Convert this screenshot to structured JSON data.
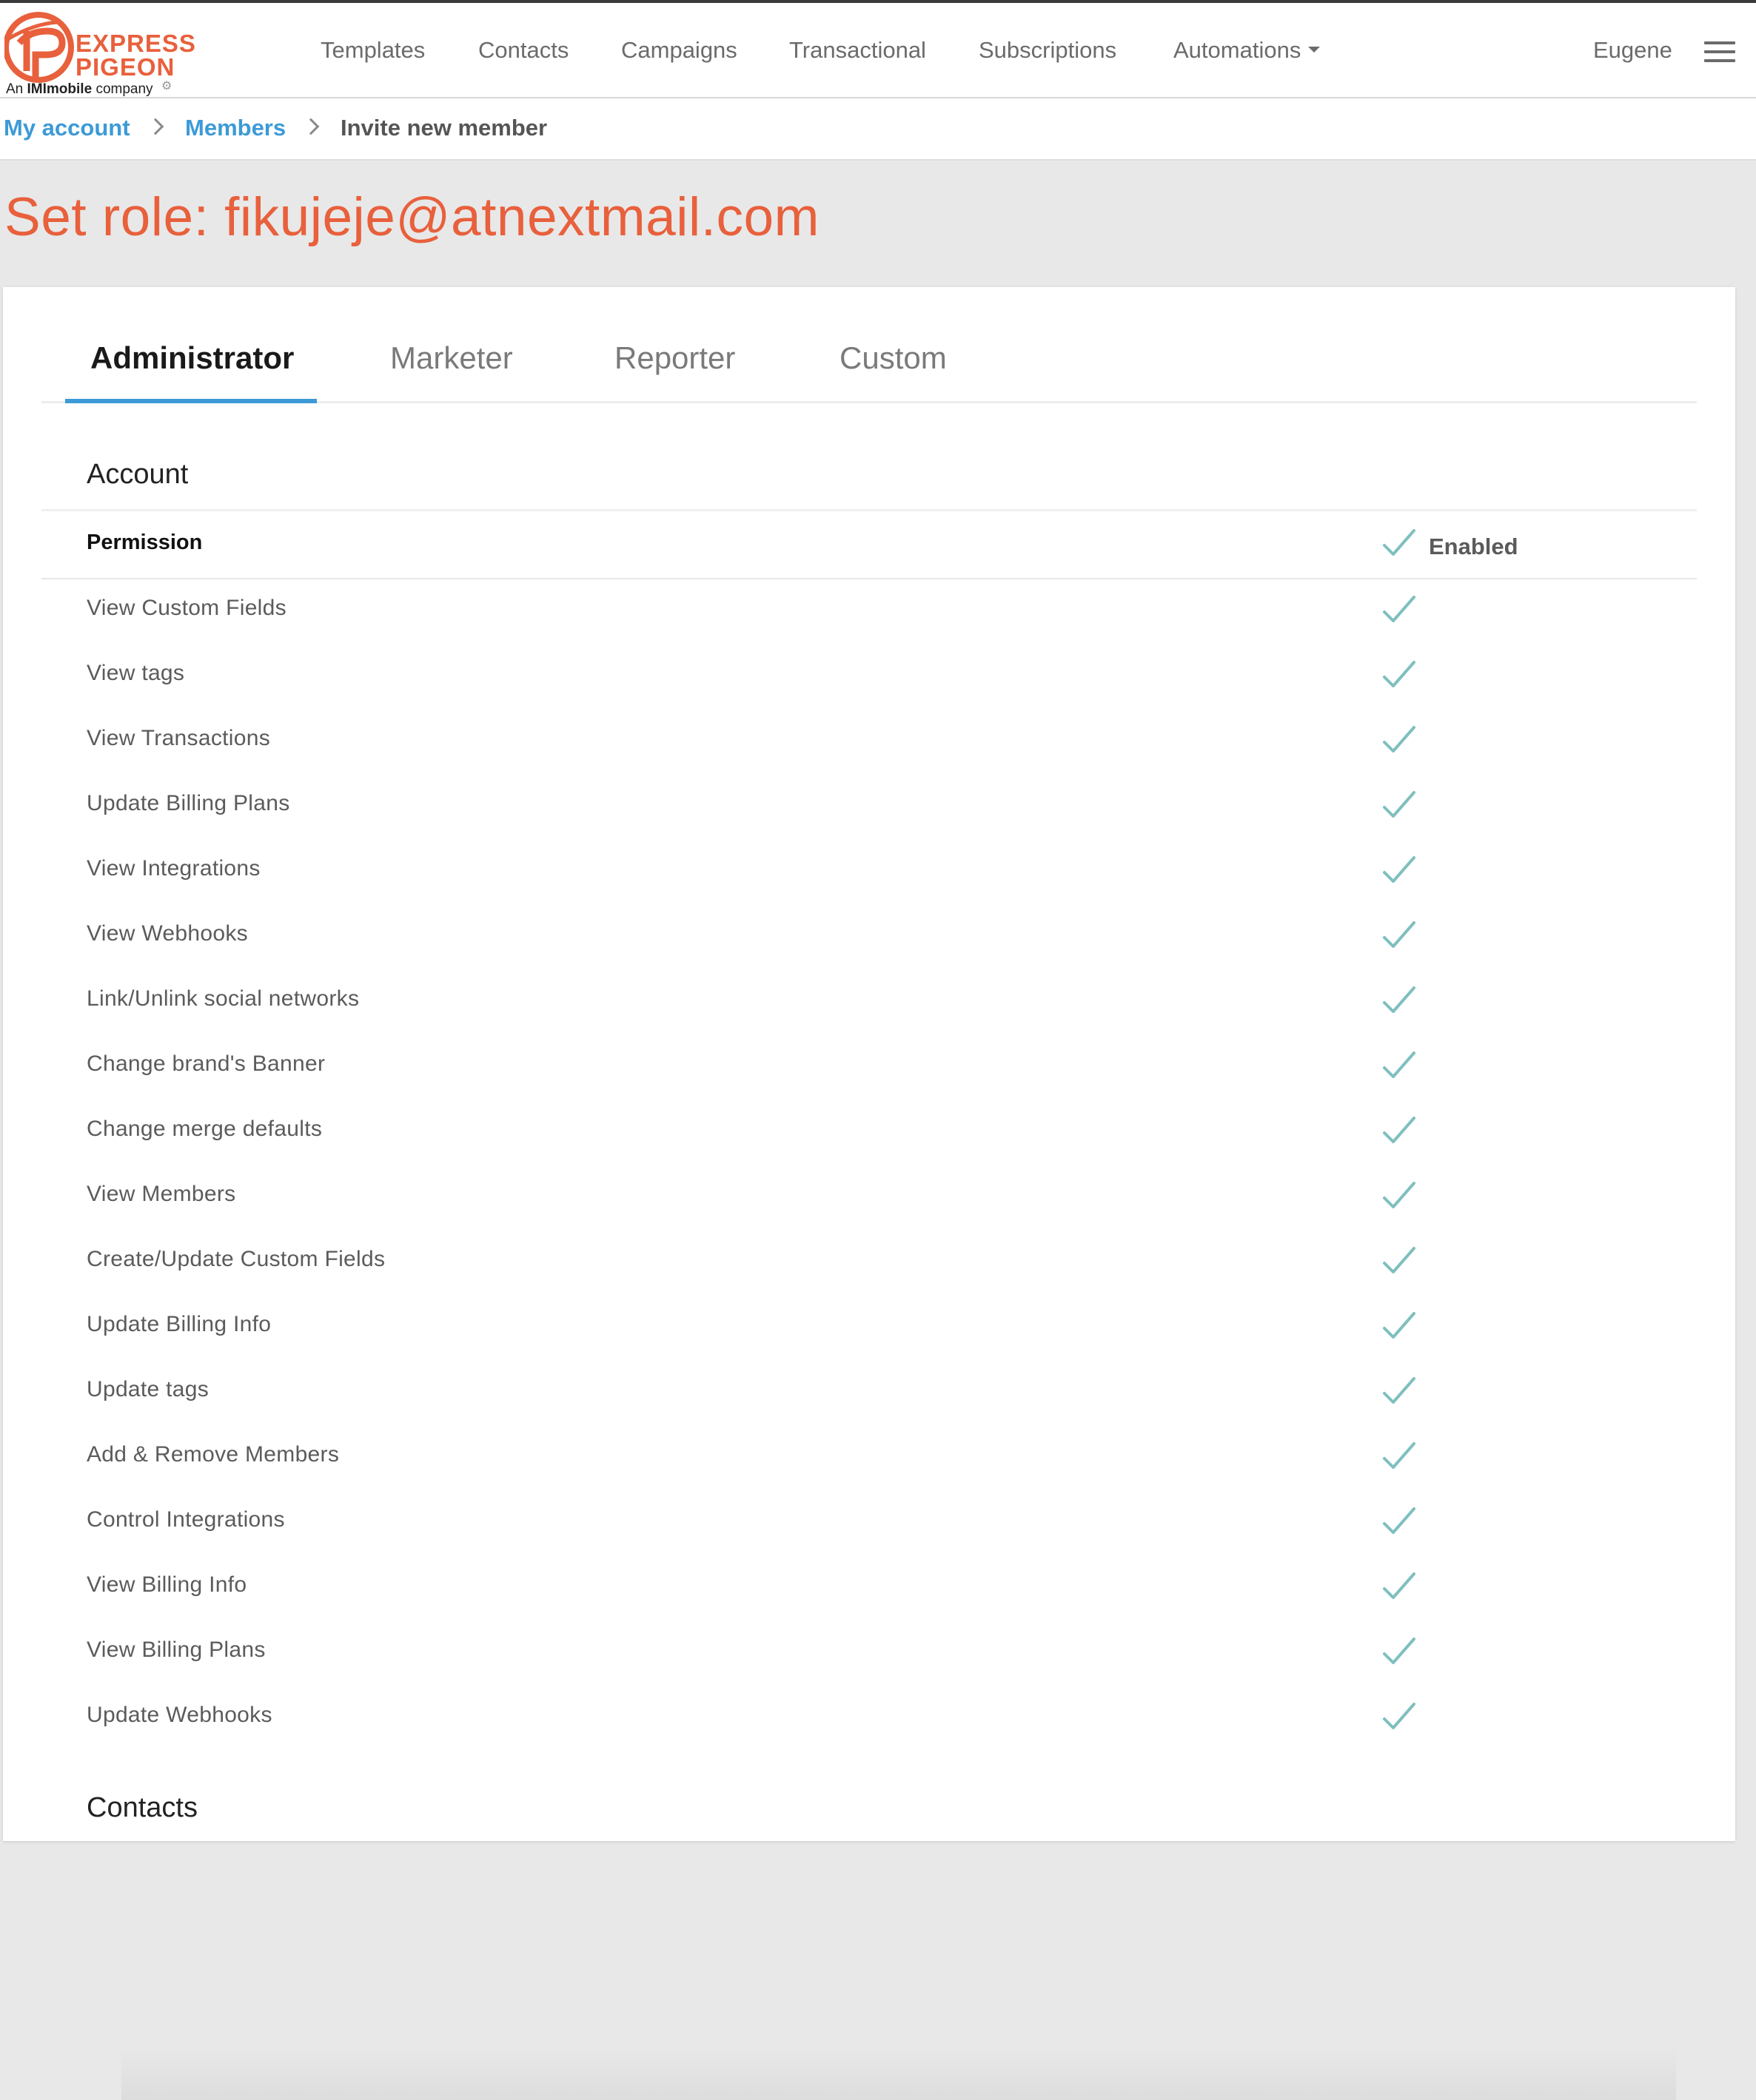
{
  "brand": {
    "line1": "EXPRESS",
    "line2": "PIGEON",
    "sub_prefix": "An",
    "sub_bold": "IMImobile",
    "sub_suffix": "company",
    "accent": "#e8603c",
    "link_color": "#3d9ad6",
    "check_color": "#7fbfbf"
  },
  "nav": {
    "items": [
      {
        "label": "Templates"
      },
      {
        "label": "Contacts"
      },
      {
        "label": "Campaigns"
      },
      {
        "label": "Transactional"
      },
      {
        "label": "Subscriptions"
      },
      {
        "label": "Automations"
      }
    ],
    "user": "Eugene"
  },
  "breadcrumb": {
    "items": [
      {
        "label": "My account"
      },
      {
        "label": "Members"
      },
      {
        "label": "Invite new member"
      }
    ]
  },
  "page": {
    "title": "Set role: fikujeje@atnextmail.com"
  },
  "tabs": [
    {
      "label": "Administrator",
      "active": true
    },
    {
      "label": "Marketer",
      "active": false
    },
    {
      "label": "Reporter",
      "active": false
    },
    {
      "label": "Custom",
      "active": false
    }
  ],
  "account_section": {
    "title": "Account",
    "header_permission": "Permission",
    "header_enabled": "Enabled",
    "permissions": [
      {
        "label": "View Custom Fields",
        "enabled": true
      },
      {
        "label": "View tags",
        "enabled": true
      },
      {
        "label": "View Transactions",
        "enabled": true
      },
      {
        "label": "Update Billing Plans",
        "enabled": true
      },
      {
        "label": "View Integrations",
        "enabled": true
      },
      {
        "label": "View Webhooks",
        "enabled": true
      },
      {
        "label": "Link/Unlink social networks",
        "enabled": true
      },
      {
        "label": "Change brand's Banner",
        "enabled": true
      },
      {
        "label": "Change merge defaults",
        "enabled": true
      },
      {
        "label": "View Members",
        "enabled": true
      },
      {
        "label": "Create/Update Custom Fields",
        "enabled": true
      },
      {
        "label": "Update Billing Info",
        "enabled": true
      },
      {
        "label": "Update tags",
        "enabled": true
      },
      {
        "label": "Add & Remove Members",
        "enabled": true
      },
      {
        "label": "Control Integrations",
        "enabled": true
      },
      {
        "label": "View Billing Info",
        "enabled": true
      },
      {
        "label": "View Billing Plans",
        "enabled": true
      },
      {
        "label": "Update Webhooks",
        "enabled": true
      }
    ]
  },
  "next_section": {
    "title": "Contacts"
  }
}
